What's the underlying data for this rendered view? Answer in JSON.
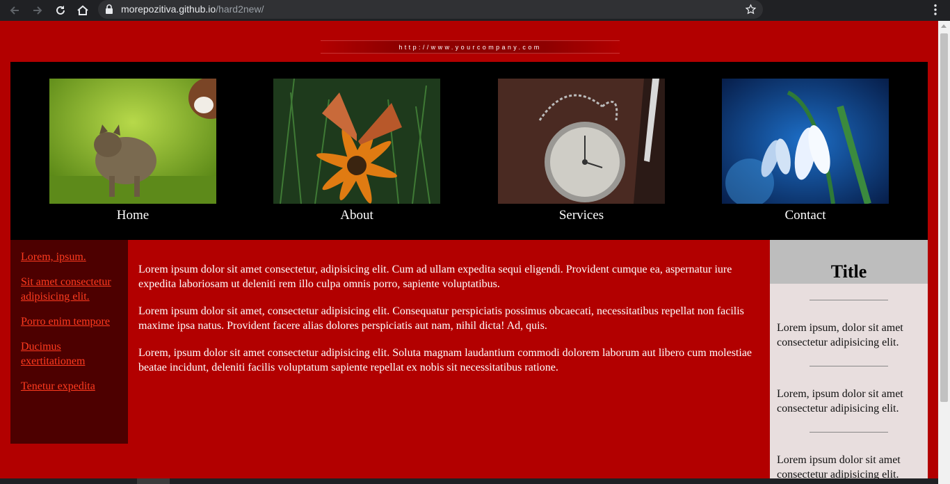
{
  "browser": {
    "url_host": "morepozitiva.github.io",
    "url_path": "/hard2new/"
  },
  "banner": {
    "text": "http://www.yourcompany.com"
  },
  "nav": [
    {
      "label": "Home",
      "image": "kitten-and-puppy-photo"
    },
    {
      "label": "About",
      "image": "butterfly-on-flower-photo"
    },
    {
      "label": "Services",
      "image": "pocket-watch-photo"
    },
    {
      "label": "Contact",
      "image": "snowdrop-flower-photo"
    }
  ],
  "sidebar": {
    "links": [
      "Lorem, ipsum.",
      "Sit amet consectetur adipisicing elit.",
      "Porro enim tempore",
      "Ducimus exertitationem",
      "Tenetur expedita"
    ]
  },
  "content": {
    "paragraphs": [
      "Lorem ipsum dolor sit amet consectetur, adipisicing elit. Cum ad ullam expedita sequi eligendi. Provident cumque ea, aspernatur iure expedita laboriosam ut deleniti rem illo culpa omnis porro, sapiente voluptatibus.",
      "Lorem ipsum dolor sit amet, consectetur adipisicing elit. Consequatur perspiciatis possimus obcaecati, necessitatibus repellat non facilis maxime ipsa natus. Provident facere alias dolores perspiciatis aut nam, nihil dicta! Ad, quis.",
      "Lorem, ipsum dolor sit amet consectetur adipisicing elit. Soluta magnam laudantium commodi dolorem laborum aut libero cum molestiae beatae incidunt, deleniti facilis voluptatum sapiente repellat ex nobis sit necessitatibus ratione."
    ]
  },
  "aside": {
    "title": "Title",
    "items": [
      "Lorem ipsum, dolor sit amet consectetur adipisicing elit.",
      "Lorem, ipsum dolor sit amet consectetur adipisicing elit.",
      "Lorem ipsum dolor sit amet consectetur adipisicing elit."
    ]
  },
  "colors": {
    "page_bg": "#b20000",
    "sidebar_bg": "#4d0000",
    "link": "#ff3b1f",
    "aside_bg": "#e8dede",
    "aside_head_bg": "#bdbdbd"
  }
}
